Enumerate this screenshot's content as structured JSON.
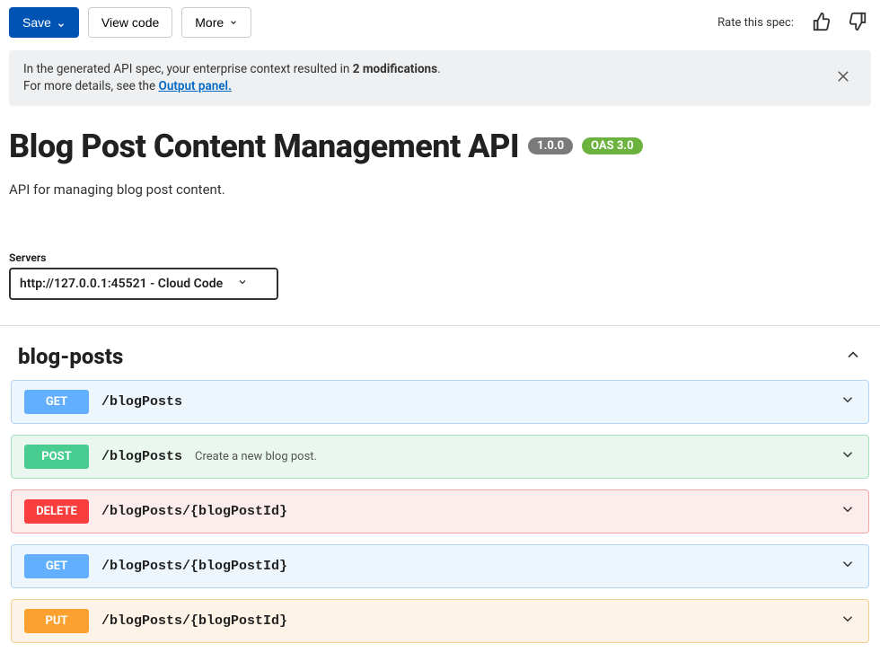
{
  "toolbar": {
    "save_label": "Save",
    "view_code_label": "View code",
    "more_label": "More",
    "rate_label": "Rate this spec:"
  },
  "banner": {
    "line1_prefix": "In the generated API spec, your enterprise context resulted in ",
    "line1_bold": "2 modifications",
    "line1_suffix": ".",
    "line2_prefix": "For more details, see the ",
    "line2_link": "Output panel."
  },
  "api": {
    "title": "Blog Post Content Management API",
    "version": "1.0.0",
    "oas_badge": "OAS 3.0",
    "description": "API for managing blog post content."
  },
  "servers": {
    "label": "Servers",
    "selected": "http://127.0.0.1:45521 - Cloud Code"
  },
  "tag": {
    "name": "blog-posts"
  },
  "ops": [
    {
      "method": "GET",
      "path": "/blogPosts",
      "summary": ""
    },
    {
      "method": "POST",
      "path": "/blogPosts",
      "summary": "Create a new blog post."
    },
    {
      "method": "DELETE",
      "path": "/blogPosts/{blogPostId}",
      "summary": ""
    },
    {
      "method": "GET",
      "path": "/blogPosts/{blogPostId}",
      "summary": ""
    },
    {
      "method": "PUT",
      "path": "/blogPosts/{blogPostId}",
      "summary": ""
    }
  ]
}
